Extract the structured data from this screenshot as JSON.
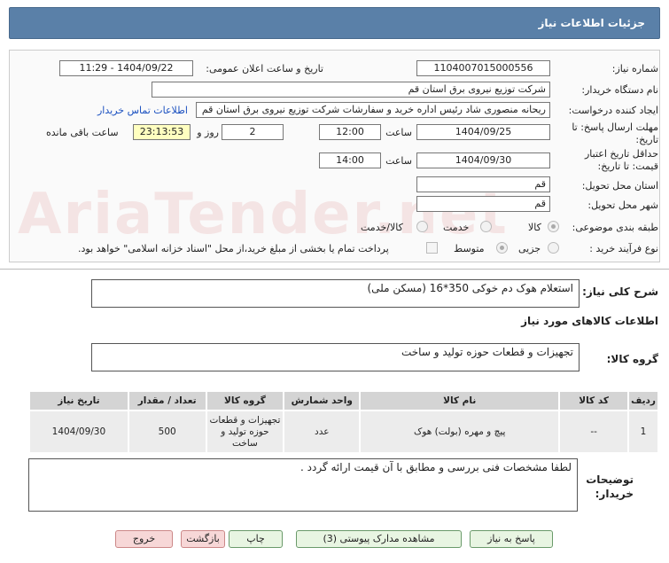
{
  "window": {
    "title": "جزئیات اطلاعات نیاز"
  },
  "watermark": {
    "text": "AriaTender.net"
  },
  "form": {
    "need_number_label": "شماره نیاز:",
    "need_number": "1104007015000556",
    "announce_label": "تاریخ و ساعت اعلان عمومی:",
    "announce_value": "1404/09/22 - 11:29",
    "buyer_org_label": "نام دستگاه خریدار:",
    "buyer_org": "شرکت توزیع نیروی برق استان قم",
    "creator_label": "ایجاد کننده درخواست:",
    "creator": "ریحانه منصوری شاد رئیس اداره خرید و سفارشات شرکت توزیع نیروی برق استان قم",
    "contact_link": "اطلاعات تماس خریدار",
    "deadline_label": "مهلت ارسال پاسخ: تا تاریخ:",
    "deadline_date": "1404/09/25",
    "time_label": "ساعت",
    "deadline_time": "12:00",
    "days_value": "2",
    "days_label": "روز و",
    "remaining_time": "23:13:53",
    "remaining_label": "ساعت باقی مانده",
    "price_validity_label": "حداقل تاریخ اعتبار قیمت: تا تاریخ:",
    "price_validity_date": "1404/09/30",
    "price_validity_time": "14:00",
    "province_label": "استان محل تحویل:",
    "province": "قم",
    "city_label": "شهر محل تحویل:",
    "city": "قم",
    "category_label": "طبقه بندی موضوعی:",
    "category_options": [
      "کالا",
      "خدمت",
      "کالا/خدمت"
    ],
    "purchase_type_label": "نوع فرآیند خرید :",
    "purchase_options": [
      "جزیی",
      "متوسط"
    ],
    "payment_note": "پرداخت تمام یا بخشی از مبلغ خرید،از محل \"اسناد خزانه اسلامی\" خواهد بود."
  },
  "description": {
    "label": "شرح کلی نیاز:",
    "text": "استعلام هوک دم خوکی 350*16 (مسکن ملی)"
  },
  "goods_info_title": "اطلاعات کالاهای مورد نیاز",
  "goods_group": {
    "label": "گروه کالا:",
    "value": "تجهیزات و قطعات حوزه تولید و ساخت"
  },
  "table": {
    "headers": [
      "ردیف",
      "کد کالا",
      "نام کالا",
      "واحد شمارش",
      "گروه کالا",
      "تعداد / مقدار",
      "تاریخ نیاز"
    ],
    "rows": [
      {
        "row": "1",
        "code": "--",
        "name": "پیچ و مهره (بولت) هوک",
        "unit": "عدد",
        "group": "تجهیزات و قطعات حوزه تولید و ساخت",
        "qty": "500",
        "date": "1404/09/30"
      }
    ]
  },
  "buyer_notes": {
    "label": "توضیحات خریدار:",
    "text": "لطفا مشخصات فنی بررسی و مطابق با آن قیمت ارائه گردد ."
  },
  "buttons": {
    "respond": "پاسخ به نیاز",
    "attachments": "مشاهده مدارک پیوستی (3)",
    "print": "چاپ",
    "back": "بازگشت",
    "exit": "خروج"
  }
}
